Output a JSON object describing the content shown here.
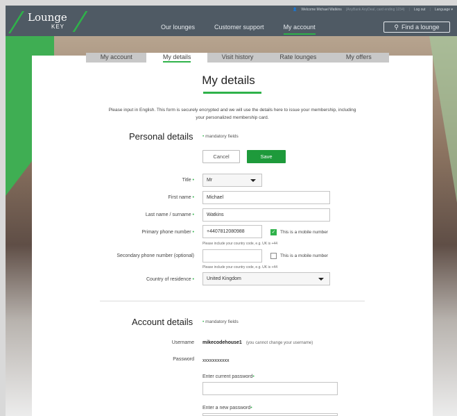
{
  "header": {
    "logo_word": "Lounge",
    "logo_key": "KEY",
    "welcome_text": "Welcome Michael Watkins",
    "welcome_detail": "(AnyBank AnyDeal, card ending 1234)",
    "logout": "Log out",
    "language": "Language ▾",
    "nav": [
      "Our lounges",
      "Customer support",
      "My account"
    ],
    "find_lounge": "Find a lounge"
  },
  "subtabs": [
    "My account",
    "My details",
    "Visit history",
    "Rate lounges",
    "My offers"
  ],
  "page": {
    "title": "My details",
    "intro": "Please input in English. This form is securely encrypted and we will use the details here to issue your membership, including your personalized membership card."
  },
  "personal": {
    "heading": "Personal details",
    "mandatory": "mandatory fields",
    "cancel": "Cancel",
    "save": "Save",
    "title_label": "Title",
    "title_value": "Mr",
    "first_name_label": "First name",
    "first_name_value": "Michael",
    "last_name_label": "Last name / surname",
    "last_name_value": "Watkins",
    "primary_phone_label": "Primary phone number",
    "primary_phone_value": "+4407812080988",
    "mobile_label": "This is a mobile number",
    "phone_hint": "Please include your country code, e.g. UK is +44",
    "secondary_phone_label": "Secondary phone number (optional)",
    "secondary_phone_value": "",
    "country_label": "Country of residence",
    "country_value": "United Kingdom"
  },
  "account": {
    "heading": "Account details",
    "mandatory": "mandatory fields",
    "username_label": "Username",
    "username_value": "mikecodehouse1",
    "username_note": "(you cannot change your username)",
    "password_label": "Password",
    "password_value": "xxxxxxxxxxx",
    "current_pw_label": "Enter current password",
    "new_pw_label": "Enter a new password"
  },
  "colors": {
    "brand_green": "#2fb24a",
    "save_green": "#1e9a3b",
    "topbar": "#4f5a64"
  }
}
